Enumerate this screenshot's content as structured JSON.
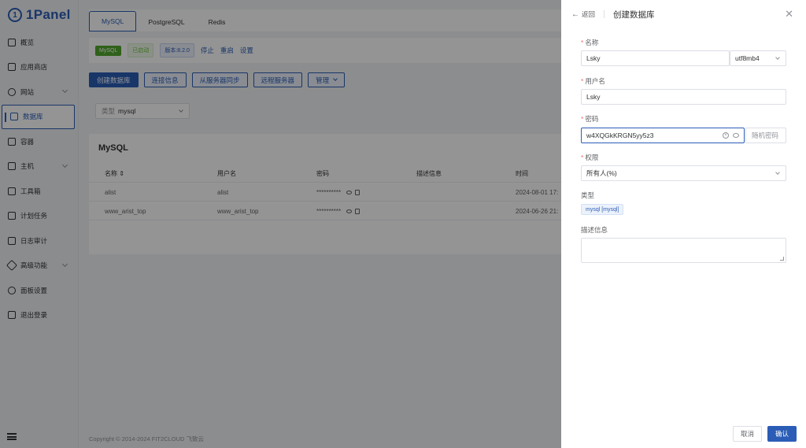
{
  "app": {
    "logo_text": "1Panel"
  },
  "sidebar": {
    "items": [
      {
        "label": "概览"
      },
      {
        "label": "应用商店"
      },
      {
        "label": "网站"
      },
      {
        "label": "数据库"
      },
      {
        "label": "容器"
      },
      {
        "label": "主机"
      },
      {
        "label": "工具箱"
      },
      {
        "label": "计划任务"
      },
      {
        "label": "日志审计"
      },
      {
        "label": "高级功能"
      },
      {
        "label": "面板设置"
      },
      {
        "label": "退出登录"
      }
    ]
  },
  "tabs": [
    {
      "label": "MySQL"
    },
    {
      "label": "PostgreSQL"
    },
    {
      "label": "Redis"
    }
  ],
  "status": {
    "app_tag": "MySQL",
    "state_tag": "已启动",
    "version_tag": "版本:8.2.0",
    "stop": "停止",
    "restart": "重启",
    "settings": "设置"
  },
  "toolbar": {
    "create": "创建数据库",
    "conn_info": "连接信息",
    "sync": "从服务器同步",
    "remote": "远程服务器",
    "manage": "管理"
  },
  "filter": {
    "label": "类型",
    "value": "mysql"
  },
  "table": {
    "title": "MySQL",
    "headers": {
      "name": "名称 ⇕",
      "user": "用户名",
      "password": "密码",
      "desc": "描述信息",
      "time": "时间"
    },
    "rows": [
      {
        "name": "alist",
        "user": "alist",
        "password": "**********",
        "desc": "",
        "time": "2024-08-01 17:"
      },
      {
        "name": "www_arist_top",
        "user": "www_arist_top",
        "password": "**********",
        "desc": "",
        "time": "2024-06-26 21:"
      }
    ]
  },
  "footer": "Copyright © 2014-2024 FIT2CLOUD 飞致云",
  "drawer": {
    "back": "返回",
    "title": "创建数据库",
    "name_label": "名称",
    "name_value": "Lsky",
    "charset_value": "utf8mb4",
    "user_label": "用户名",
    "user_value": "Lsky",
    "password_label": "密码",
    "password_value": "w4XQGkKRGN5yy5z3",
    "random_password": "随机密码",
    "perm_label": "权限",
    "perm_value": "所有人(%)",
    "type_label": "类型",
    "type_value": "mysql [mysql]",
    "desc_label": "描述信息",
    "cancel": "取消",
    "confirm": "确认"
  }
}
